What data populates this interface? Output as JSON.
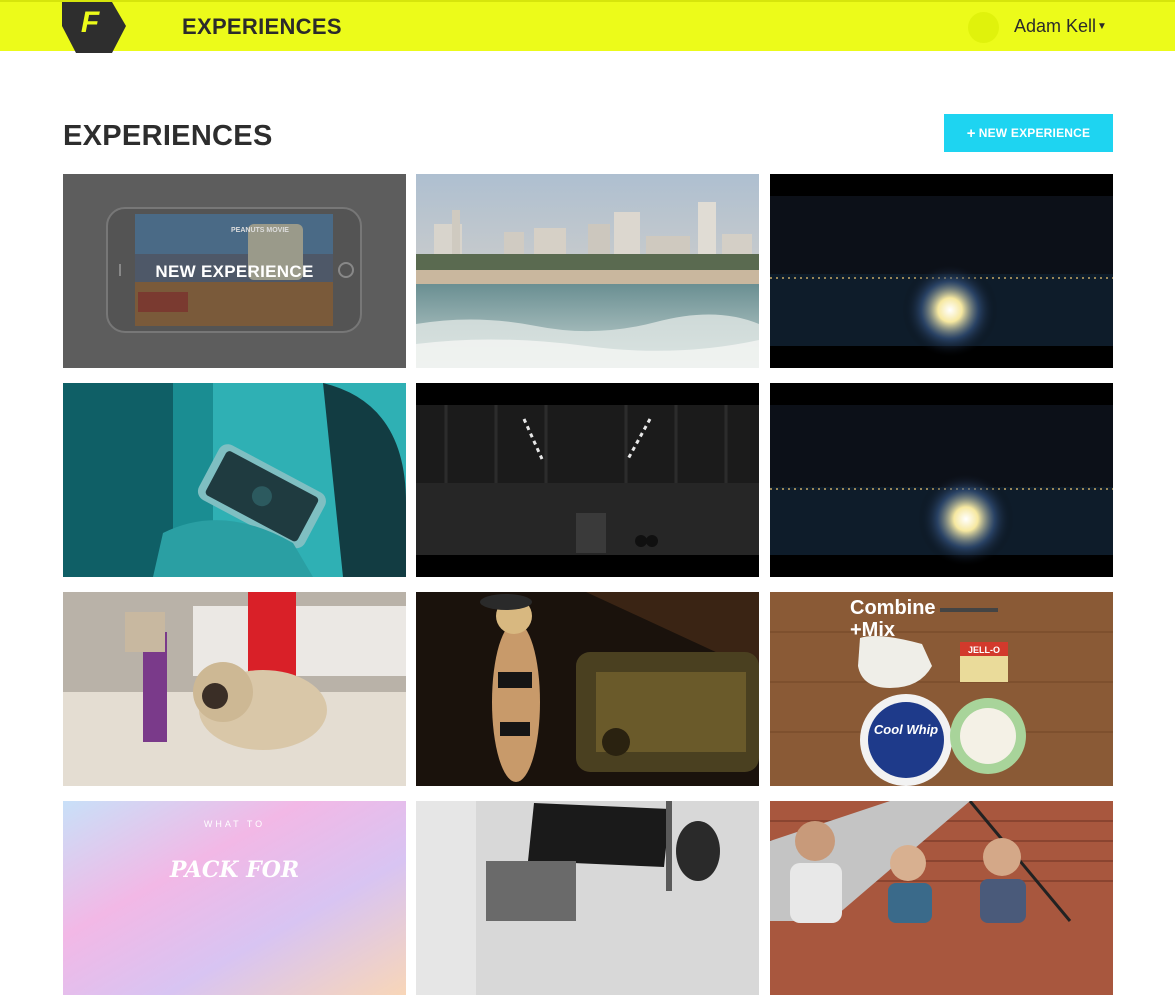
{
  "header": {
    "title": "EXPERIENCES",
    "user_name": "Adam Kell",
    "logo_letter": "F",
    "accent_color": "#ecfb1a"
  },
  "main": {
    "page_title": "EXPERIENCES",
    "new_button_plus": "+",
    "new_button_label": "NEW EXPERIENCE",
    "button_color": "#1ed4f1",
    "tiles": [
      {
        "caption": "NEW EXPERIENCE",
        "icon": "trash-icon",
        "thumb_text": "PEANUTS MOVIE"
      },
      {
        "thumb": "city-beach-skyline"
      },
      {
        "thumb": "night-lights"
      },
      {
        "thumb": "teal-hand-phone"
      },
      {
        "thumb": "dark-hangar"
      },
      {
        "thumb": "night-lights"
      },
      {
        "thumb": "pug-on-carpet"
      },
      {
        "thumb": "dancer-car"
      },
      {
        "thumb": "recipe-table",
        "line1": "Combine",
        "line2": "+Mix",
        "label1": "JELL-O",
        "label2": "Cool Whip"
      },
      {
        "thumb": "pastel-gradient",
        "small_text": "WHAT TO",
        "script_text": "PACK FOR"
      },
      {
        "thumb": "bw-music-stand"
      },
      {
        "thumb": "three-men-stairs"
      }
    ]
  }
}
